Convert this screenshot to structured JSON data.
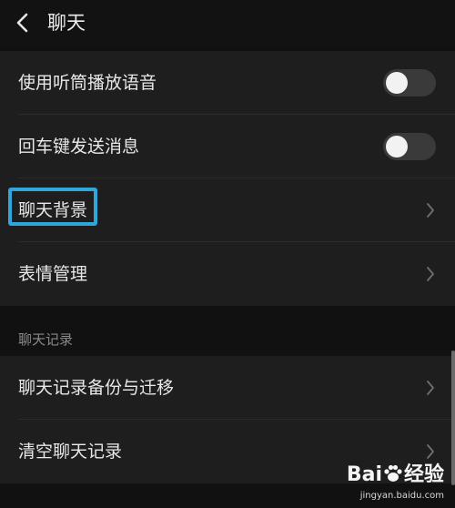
{
  "header": {
    "title": "聊天",
    "back_icon": "chevron-left-icon"
  },
  "settings": {
    "use_earpiece": {
      "label": "使用听筒播放语音",
      "enabled": false
    },
    "enter_to_send": {
      "label": "回车键发送消息",
      "enabled": false
    },
    "chat_background": {
      "label": "聊天背景",
      "highlighted": true,
      "highlight_color": "#2fa7dc"
    },
    "sticker_management": {
      "label": "表情管理"
    }
  },
  "chat_history": {
    "section_title": "聊天记录",
    "backup_migrate": {
      "label": "聊天记录备份与迁移"
    },
    "clear_history": {
      "label": "清空聊天记录"
    }
  },
  "watermark": {
    "brand_prefix": "Bai",
    "brand_suffix": "经验",
    "url": "jingyan.baidu.com"
  },
  "colors": {
    "background": "#111111",
    "group_background": "#1e1e1e",
    "toggle_off": "#3a3a3a",
    "accent_highlight": "#2fa7dc"
  }
}
